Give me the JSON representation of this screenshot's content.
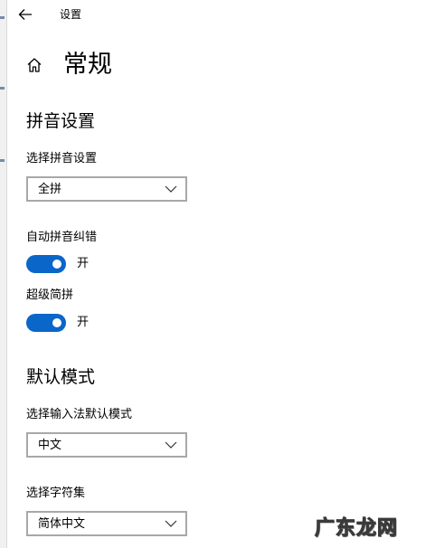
{
  "window": {
    "title": "设置"
  },
  "header": {
    "title": "常规"
  },
  "sections": [
    {
      "title": "拼音设置",
      "pinyin_select": {
        "label": "选择拼音设置",
        "value": "全拼"
      },
      "auto_correct": {
        "label": "自动拼音纠错",
        "state_text": "开",
        "on": true
      },
      "super_jianpin": {
        "label": "超级简拼",
        "state_text": "开",
        "on": true
      }
    },
    {
      "title": "默认模式",
      "default_mode_select": {
        "label": "选择输入法默认模式",
        "value": "中文"
      },
      "charset_select": {
        "label": "选择字符集",
        "value": "简体中文"
      }
    }
  ],
  "watermark": "广东龙网",
  "colors": {
    "accent": "#0a66c9",
    "border": "#a8a8a8"
  },
  "icons": {
    "back": "back-arrow-icon",
    "home": "home-icon",
    "dropdown": "chevron-down-icon"
  }
}
